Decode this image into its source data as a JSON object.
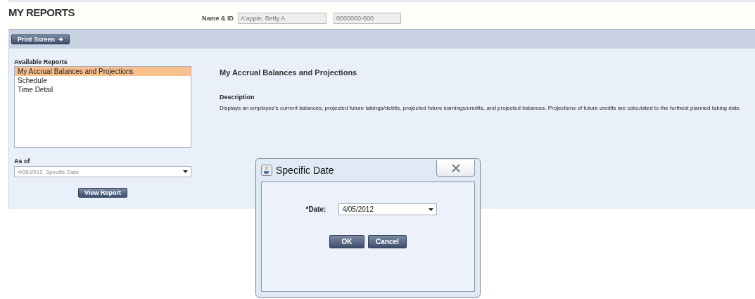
{
  "header": {
    "title": "MY REPORTS",
    "name_id_label": "Name & ID",
    "name_value": "A'apple, Betty A",
    "id_value": "0000000-000"
  },
  "toolbar": {
    "print_button": "Print Screen"
  },
  "reports": {
    "label": "Available Reports",
    "items": [
      {
        "label": "My Accrual Balances and Projections",
        "selected": true
      },
      {
        "label": "Schedule",
        "selected": false
      },
      {
        "label": "Time Detail",
        "selected": false
      }
    ]
  },
  "as_of": {
    "label": "As of",
    "value": "4/05/2012, Specific Date"
  },
  "view_button": "View Report",
  "detail": {
    "title": "My Accrual Balances and Projections",
    "description_label": "Description",
    "description": "Displays an employee's current balances, projected future takings/debits, projected future earnings/credits, and projected balances.  Projections of future credits are calculated to the furthest planned taking date."
  },
  "dialog": {
    "title": "Specific Date",
    "date_label": "*Date:",
    "date_value": "4/05/2012",
    "buttons": [
      "OK",
      "Cancel"
    ]
  }
}
